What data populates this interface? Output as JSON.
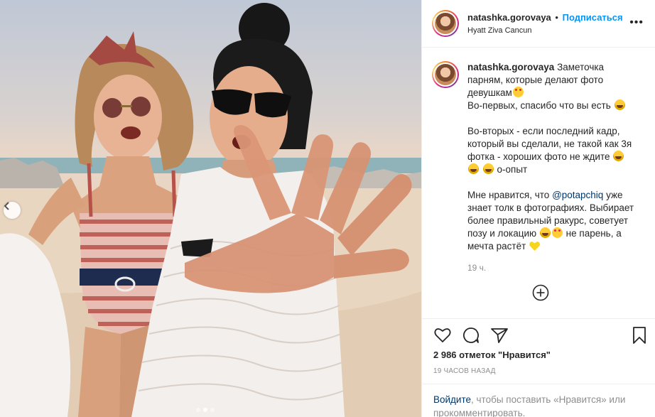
{
  "post": {
    "username": "natashka.gorovaya",
    "separator": "•",
    "follow_label": "Подписаться",
    "location": "Hyatt Ziva Cancun",
    "more_label": "•••"
  },
  "caption": {
    "username": "natashka.gorovaya",
    "line1": "Заметочка парням, которые делают фото девушкам",
    "line2": "Во-первых, спасибо что вы есть",
    "line3a": "Во-вторых - если последний кадр, который вы сделали, не такой как 3я фотка - хороших фото не ждите",
    "line3b": "о-опыт",
    "line4a": "Мне нравится, что ",
    "mention": "@potapchiq",
    "line4b": " уже знает толк в фотографиях. Выбирает более правильный ракурс, советует позу и локацию",
    "line4c": " не парень, а мечта растёт",
    "timestamp": "19 ч."
  },
  "stats": {
    "likes": "2 986 отметок \"Нравится\"",
    "posted": "19 часов назад"
  },
  "login": {
    "link": "Войдите",
    "rest": ", чтобы поставить «Нравится» или прокомментировать."
  },
  "icons": {
    "like": "heart-outline-icon",
    "comment": "comment-bubble-icon",
    "share": "paper-plane-icon",
    "save": "bookmark-icon",
    "add": "plus-circle-icon",
    "prev": "chevron-left-icon"
  },
  "carousel": {
    "slides": 3,
    "active_index": 1
  },
  "colors": {
    "follow": "#0095f6",
    "link": "#00376b",
    "muted": "#8e8e8e",
    "text": "#262626"
  }
}
